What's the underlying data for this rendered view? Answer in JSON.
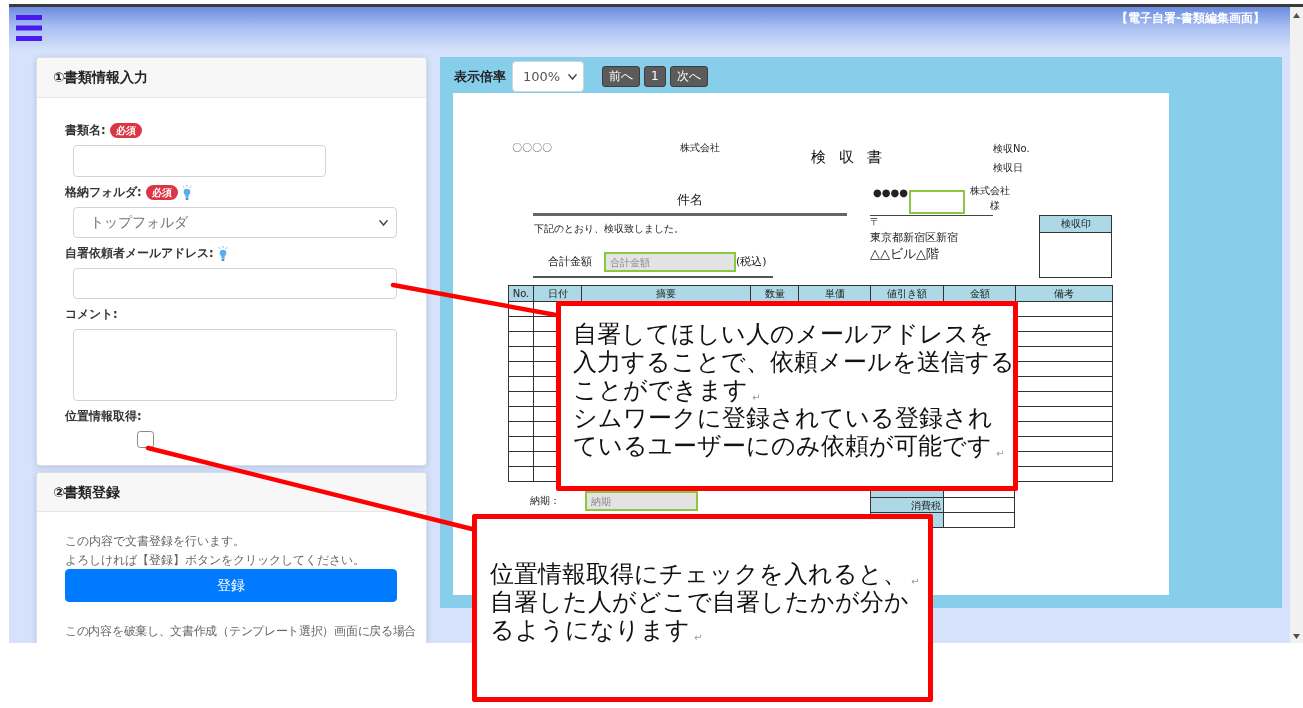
{
  "header": {
    "title": "【電子自署-書類編集画面】"
  },
  "info_card": {
    "title": "①書類情報入力",
    "fields": [
      {
        "kind": "short_text",
        "label": "書類名:",
        "badge": "必須",
        "help_icon": false
      },
      {
        "kind": "select",
        "label": "格納フォルダ:",
        "badge": "必須",
        "help_icon": true,
        "value": "トップフォルダ"
      },
      {
        "kind": "text",
        "label": "自署依頼者メールアドレス:",
        "help_icon": true
      },
      {
        "kind": "textarea",
        "label": "コメント:",
        "help_icon": false
      },
      {
        "kind": "checkbox",
        "label": "位置情報取得:",
        "help_icon": false,
        "checked": false
      }
    ]
  },
  "register_card": {
    "title": "②書類登録",
    "messages": [
      "この内容で文書登録を行います。",
      "よろしければ【登録】ボタンをクリックしてください。"
    ],
    "button": "登録",
    "note": "この内容を破棄し、文書作成（テンプレート選択）画面に戻る場合"
  },
  "viewer": {
    "zoom_label": "表示倍率",
    "zoom_value": "100%",
    "buttons": [
      "前へ",
      "1",
      "次へ"
    ]
  },
  "document": {
    "company": "〇〇〇〇",
    "company_suffix": "株式会社",
    "title": "検　収　書",
    "meta": [
      "検収No.",
      "検収日"
    ],
    "subject_label": "件名",
    "statement": "下記のとおり、検収致しました。",
    "total": {
      "label": "合計金額",
      "placeholder": "合計金額",
      "suffix": "(税込)"
    },
    "recipient": {
      "name": "●●●●",
      "company_suffix": "株式会社",
      "honorific": "様"
    },
    "postal_mark": "〒",
    "address": [
      "東京都新宿区新宿",
      "△△ビル△階"
    ],
    "stamp_label": "検収印",
    "table": {
      "columns": [
        "No.",
        "日付",
        "摘要",
        "数量",
        "単価",
        "値引き額",
        "金額",
        "備考"
      ]
    },
    "due_date": {
      "label": "納期：",
      "placeholder": "納期"
    },
    "tax_label": "消費税"
  },
  "callouts": [
    {
      "lines": [
        "自署してほしい人のメールアドレスを",
        "入力することで、依頼メールを送信する",
        "ことができます$_{↵}$",
        "シムワークに登録されている登録され",
        "ているユーザーにのみ依頼が可能です$_{↵}$"
      ]
    },
    {
      "lines": [
        "位置情報取得にチェックを入れると、$_{↵}$",
        "自署した人がどこで自署したかが分か",
        "るようになります$_{↵}$"
      ]
    }
  ]
}
